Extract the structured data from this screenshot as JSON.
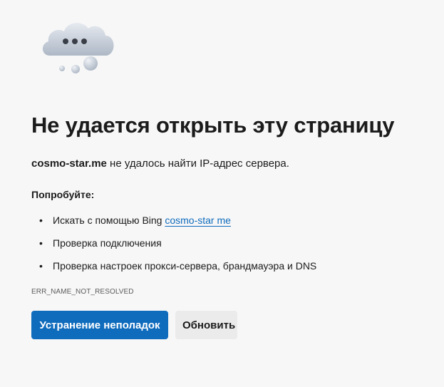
{
  "illustration": {
    "icon": "cloud-dots-icon"
  },
  "error": {
    "title": "Не удается открыть эту страницу",
    "host": "cosmo-star.me",
    "message_rest": " не удалось найти IP-адрес сервера.",
    "try_label": "Попробуйте:",
    "suggestions": {
      "search_prefix": "Искать с помощью Bing ",
      "search_link": "cosmo-star me",
      "check_connection": "Проверка подключения",
      "check_proxy": "Проверка настроек прокси-сервера, брандмауэра и DNS"
    },
    "bullet": "•",
    "code": "ERR_NAME_NOT_RESOLVED"
  },
  "buttons": {
    "troubleshoot": "Устранение неполадок",
    "refresh": "Обновить"
  },
  "colors": {
    "background": "#f7f7f7",
    "primary": "#0f6cbd",
    "secondary_button": "#ebebeb",
    "text": "#1b1b1b"
  }
}
